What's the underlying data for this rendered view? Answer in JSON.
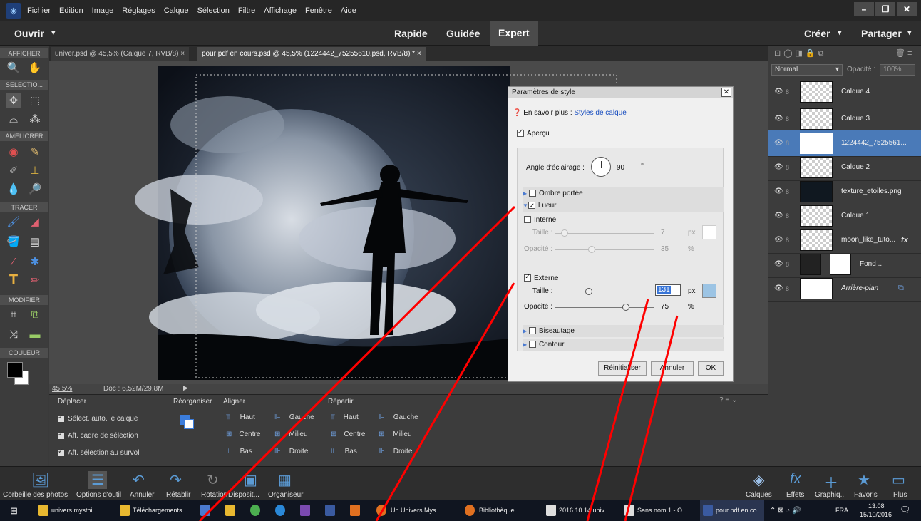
{
  "menu": {
    "items": [
      "Fichier",
      "Edition",
      "Image",
      "Réglages",
      "Calque",
      "Sélection",
      "Filtre",
      "Affichage",
      "Fenêtre",
      "Aide"
    ]
  },
  "modebar": {
    "open": "Ouvrir",
    "quick": "Rapide",
    "guided": "Guidée",
    "expert": "Expert",
    "create": "Créer",
    "share": "Partager"
  },
  "tools": {
    "sections": [
      "AFFICHER",
      "SELECTIO...",
      "AMELIORER",
      "TRACER",
      "MODIFIER",
      "COULEUR"
    ]
  },
  "tabs": [
    "univer.psd @ 45,5% (Calque 7, RVB/8)",
    "pour pdf en cours.psd @ 45,5% (1224442_75255610.psd, RVB/8) *"
  ],
  "status": {
    "zoom": "45,5%",
    "doc": "Doc : 6,52M/29,8M"
  },
  "options": {
    "move": "Déplacer",
    "reorg": "Réorganiser",
    "align": "Aligner",
    "distribute": "Répartir",
    "auto_select": "Sélect. auto. le calque",
    "bbox": "Aff. cadre de sélection",
    "hover": "Aff. sélection au survol",
    "haut": "Haut",
    "centre": "Centre",
    "bas": "Bas",
    "gauche": "Gauche",
    "milieu": "Milieu",
    "droite": "Droite"
  },
  "dialog": {
    "title": "Paramètres de style",
    "learn": "En savoir plus :",
    "learn_link": "Styles de calque",
    "preview": "Aperçu",
    "angle_label": "Angle d'éclairage :",
    "angle_value": "90",
    "angle_unit": "°",
    "drop_shadow": "Ombre portée",
    "glow": "Lueur",
    "inner": "Interne",
    "size": "Taille :",
    "opacity": "Opacité :",
    "inner_size": "7",
    "inner_opacity": "35",
    "outer": "Externe",
    "outer_size": "131",
    "outer_opacity": "75",
    "px": "px",
    "pct": "%",
    "bevel": "Biseautage",
    "stroke": "Contour",
    "reset": "Réinitialiser",
    "cancel": "Annuler",
    "ok": "OK"
  },
  "layers": {
    "mode": "Normal",
    "opacity_label": "Opacité :",
    "opacity_value": "100%",
    "items": [
      "Calque 4",
      "Calque 3",
      "1224442_7525561...",
      "Calque 2",
      "texture_etoiles.png",
      "Calque 1",
      "moon_like_tuto...",
      "Fond ...",
      "Arrière-plan"
    ]
  },
  "bottom": {
    "items": [
      "Corbeille des photos",
      "Options d'outil",
      "Annuler",
      "Rétablir",
      "Rotation",
      "Disposit...",
      "Organiseur"
    ],
    "right": [
      "Calques",
      "Effets",
      "Graphiq...",
      "Favoris",
      "Plus"
    ]
  },
  "taskbar": {
    "items": [
      "univers mysthi...",
      "Téléchargements",
      "Un Univers Mys...",
      "Bibliothèque",
      "2016 10 14 univ...",
      "Sans nom 1 - O...",
      "pour pdf en co..."
    ],
    "lang": "FRA",
    "time": "13:08",
    "date": "15/10/2016"
  }
}
